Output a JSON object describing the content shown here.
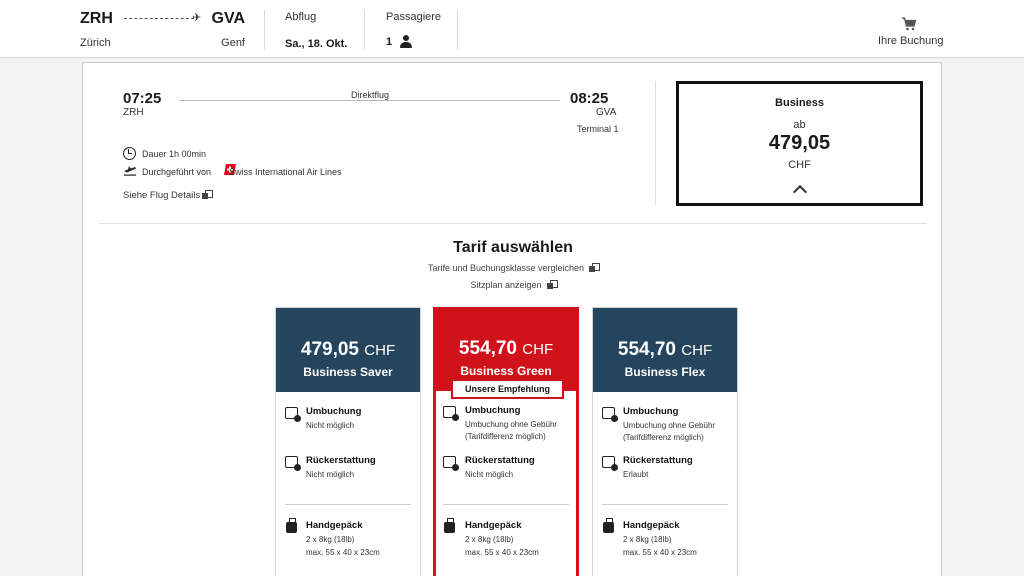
{
  "header": {
    "from_code": "ZRH",
    "to_code": "GVA",
    "from_city": "Zürich",
    "to_city": "Genf",
    "departure_label": "Abflug",
    "departure_value": "Sa., 18. Okt.",
    "passengers_label": "Passagiere",
    "passengers_value": "1",
    "booking_label": "Ihre Buchung"
  },
  "flight": {
    "dep_time": "07:25",
    "dep_code": "ZRH",
    "arr_time": "08:25",
    "arr_code": "GVA",
    "arr_terminal": "Terminal 1",
    "type": "Direktflug",
    "duration_label": "Dauer",
    "duration_value": "1h 00min",
    "operated_label": "Durchgeführt von",
    "airline": "Swiss International Air Lines",
    "details_link": "Siehe Flug Details"
  },
  "business_summary": {
    "title": "Business",
    "from_label": "ab",
    "price": "479,05",
    "currency": "CHF"
  },
  "tarif": {
    "title": "Tarif auswählen",
    "compare_link": "Tarife und Buchungsklasse vergleichen",
    "seatmap_link": "Sitzplan anzeigen"
  },
  "fares": [
    {
      "price": "479,05",
      "currency": "CHF",
      "name": "Business Saver",
      "rebooking_title": "Umbuchung",
      "rebooking_text": "Nicht möglich",
      "refund_title": "Rückerstattung",
      "refund_text": "Nicht möglich",
      "baggage_title": "Handgepäck",
      "baggage_line1": "2 x 8kg (18lb)",
      "baggage_line2": "max. 55 x 40 x 23cm"
    },
    {
      "price": "554,70",
      "currency": "CHF",
      "name": "Business Green",
      "badge": "Unsere Empfehlung",
      "rebooking_title": "Umbuchung",
      "rebooking_text": "Umbuchung ohne Gebühr",
      "rebooking_text2": "(Tarifdifferenz möglich)",
      "refund_title": "Rückerstattung",
      "refund_text": "Nicht möglich",
      "baggage_title": "Handgepäck",
      "baggage_line1": "2 x 8kg (18lb)",
      "baggage_line2": "max. 55 x 40 x 23cm"
    },
    {
      "price": "554,70",
      "currency": "CHF",
      "name": "Business Flex",
      "rebooking_title": "Umbuchung",
      "rebooking_text": "Umbuchung ohne Gebühr",
      "rebooking_text2": "(Tarifdifferenz möglich)",
      "refund_title": "Rückerstattung",
      "refund_text": "Erlaubt",
      "baggage_title": "Handgepäck",
      "baggage_line1": "2 x 8kg (18lb)",
      "baggage_line2": "max. 55 x 40 x 23cm"
    }
  ],
  "colors": {
    "fare_header": "#25445e",
    "recommended": "#d0121b",
    "swiss_red": "#e2001a"
  }
}
